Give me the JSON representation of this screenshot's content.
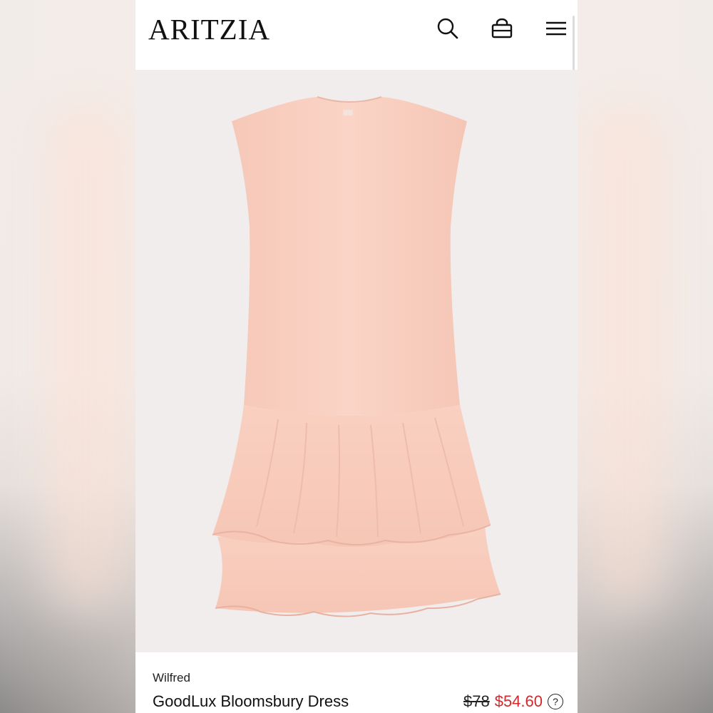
{
  "header": {
    "logo": "ARITZIA",
    "icons": [
      "search-icon",
      "shopping-bag-icon",
      "hamburger-menu-icon"
    ]
  },
  "product": {
    "image": "light peach sleeveless drop-waist dress with tiered ruffle skirt",
    "image_color": "#f8cfc0",
    "brand": "Wilfred",
    "name": "GoodLux Bloomsbury Dress",
    "original_price": "$78",
    "sale_price": "$54.60",
    "sale_color": "#d0292e",
    "help_symbol": "?"
  }
}
